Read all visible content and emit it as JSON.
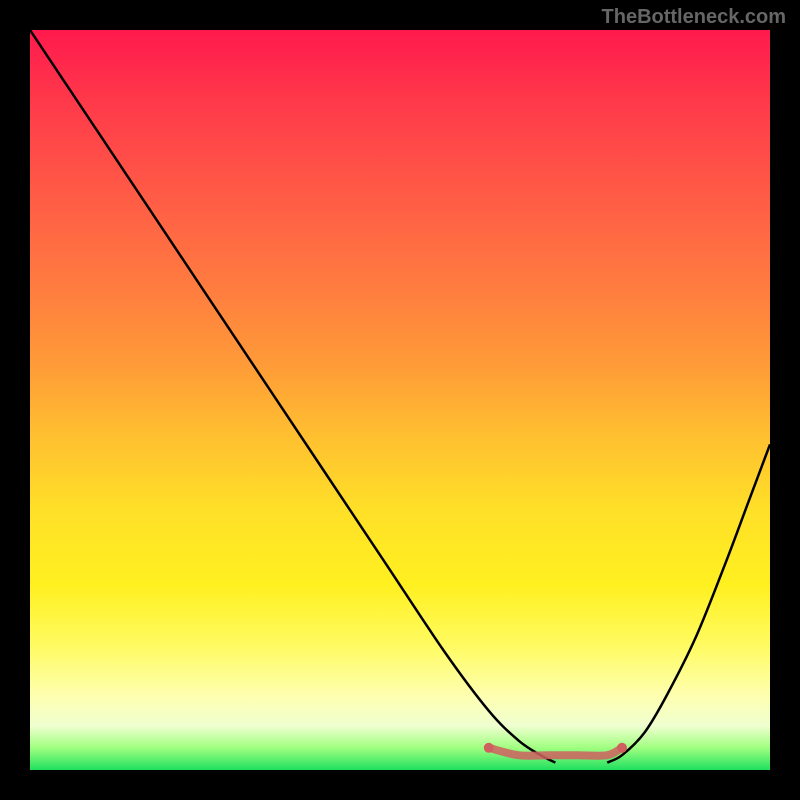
{
  "attribution": "TheBottleneck.com",
  "chart_data": {
    "type": "line",
    "title": "",
    "xlabel": "",
    "ylabel": "",
    "xlim": [
      0,
      100
    ],
    "ylim": [
      0,
      100
    ],
    "series": [
      {
        "name": "left-curve",
        "x": [
          0,
          8,
          16,
          24,
          32,
          40,
          48,
          56,
          62,
          66,
          69,
          71
        ],
        "values": [
          100,
          88,
          76,
          64,
          52,
          40,
          28,
          16,
          8,
          4,
          2,
          1
        ]
      },
      {
        "name": "right-curve",
        "x": [
          78,
          80,
          83,
          86,
          90,
          94,
          97,
          100
        ],
        "values": [
          1,
          2,
          5,
          10,
          18,
          28,
          36,
          44
        ]
      },
      {
        "name": "optimal-band",
        "x": [
          62,
          66,
          70,
          74,
          78,
          80
        ],
        "values": [
          3,
          2,
          2,
          2,
          2,
          3
        ]
      }
    ],
    "gradient_colors": {
      "top": "#ff1a4d",
      "mid": "#ffe028",
      "bottom": "#20e060"
    }
  }
}
